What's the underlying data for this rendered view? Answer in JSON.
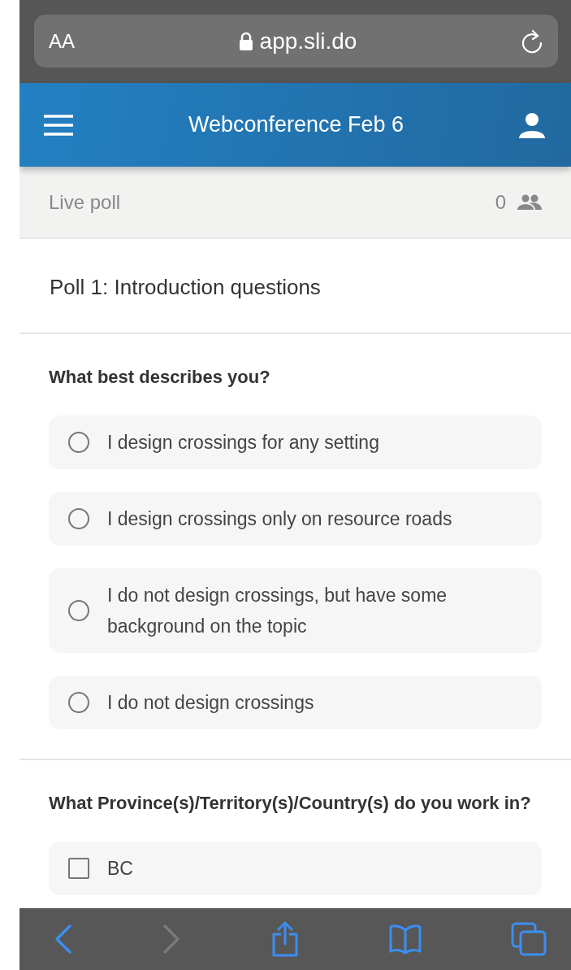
{
  "browser": {
    "text_size": "AA",
    "url": "app.sli.do"
  },
  "header": {
    "title": "Webconference Feb 6"
  },
  "live_bar": {
    "label": "Live poll",
    "count": "0"
  },
  "poll": {
    "title": "Poll 1: Introduction questions",
    "questions": [
      {
        "text": "What best describes you?",
        "kind": "radio",
        "options": [
          {
            "label": "I design crossings for any setting",
            "selected": false
          },
          {
            "label": "I design crossings only on resource roads",
            "selected": false
          },
          {
            "label": "I do not design crossings, but have some background on the topic",
            "selected": false
          },
          {
            "label": "I do not design crossings",
            "selected": false
          }
        ]
      },
      {
        "text": "What Province(s)/Territory(s)/Country(s) do you work in?",
        "kind": "checkbox",
        "options": [
          {
            "label": "BC",
            "selected": false
          }
        ]
      }
    ]
  },
  "toolbar": [
    {
      "kind": "back",
      "disabled": false
    },
    {
      "kind": "forward",
      "disabled": true
    },
    {
      "kind": "share",
      "disabled": false
    },
    {
      "kind": "bookmarks",
      "disabled": false
    },
    {
      "kind": "tabs",
      "disabled": false
    }
  ]
}
